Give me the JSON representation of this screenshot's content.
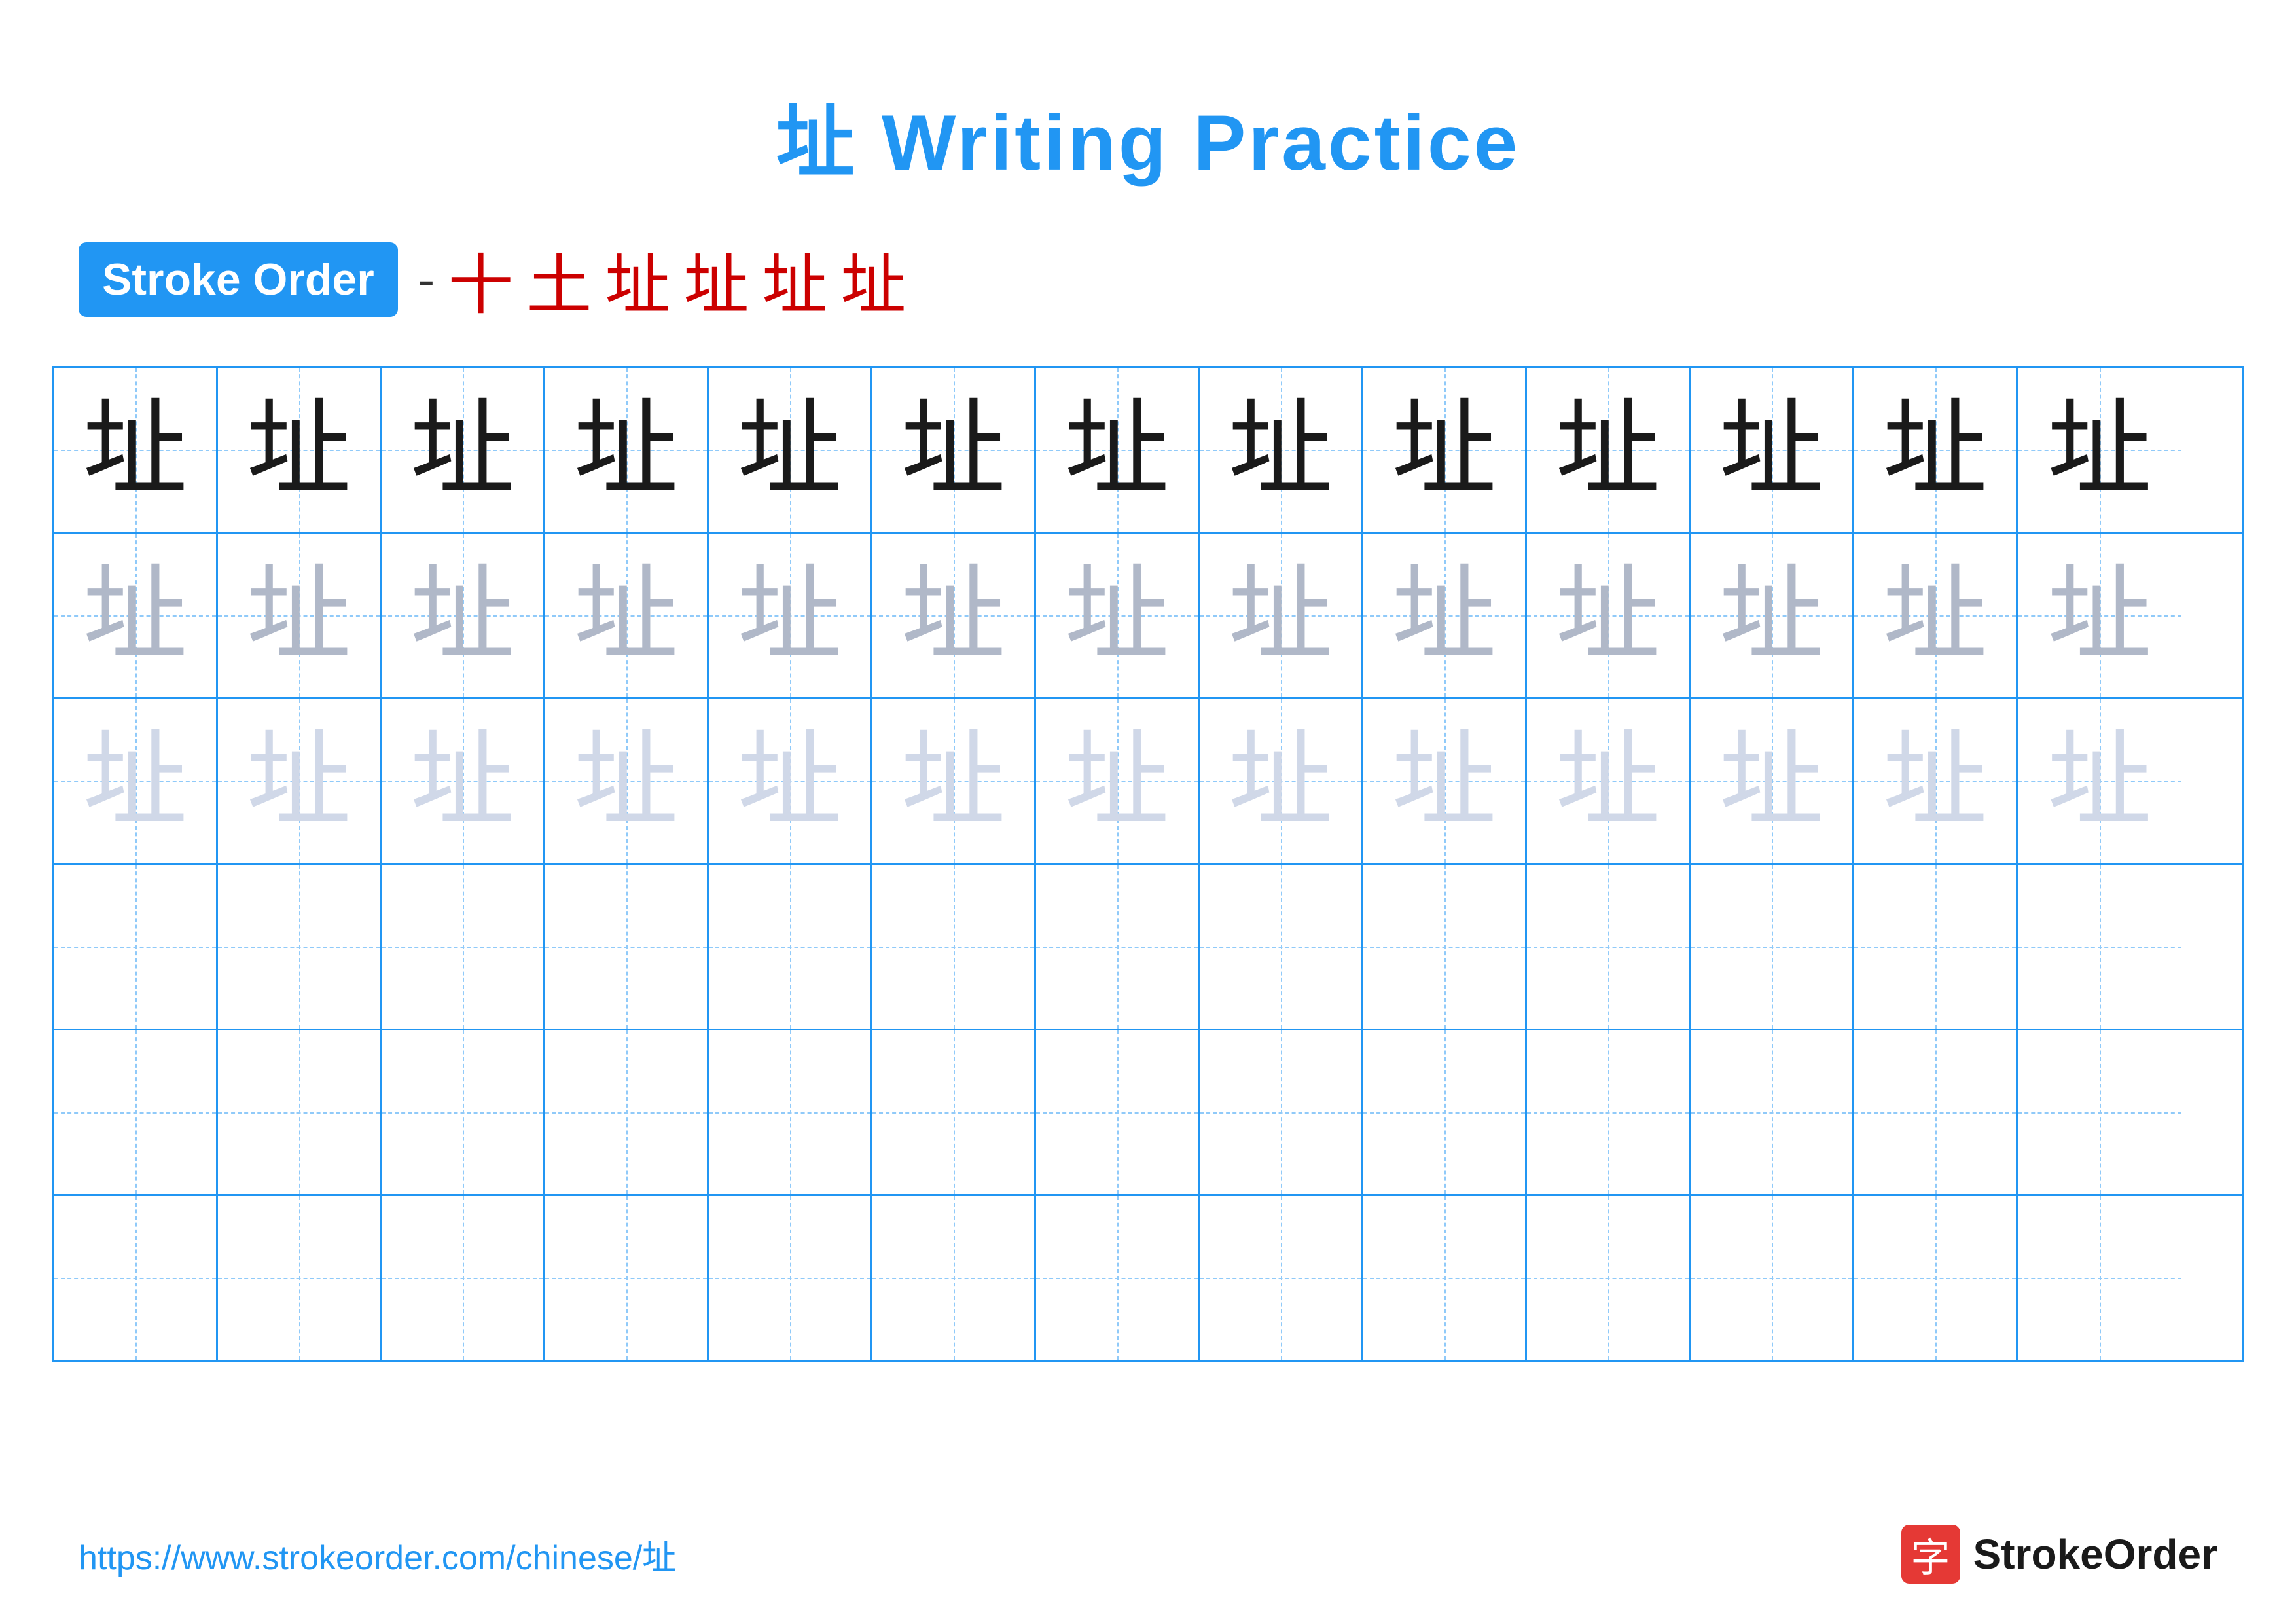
{
  "title": {
    "text": "址 Writing Practice",
    "color": "#2196F3"
  },
  "stroke_order": {
    "badge_label": "Stroke Order",
    "dash": "-",
    "strokes": [
      "一",
      "十",
      "土",
      "址",
      "址",
      "址",
      "址"
    ]
  },
  "grid": {
    "rows": 6,
    "cols": 13,
    "char": "址",
    "row_styles": [
      "dark",
      "medium",
      "light",
      "empty",
      "empty",
      "empty"
    ]
  },
  "footer": {
    "url": "https://www.strokeorder.com/chinese/址",
    "logo_char": "字",
    "logo_name": "StrokeOrder"
  }
}
